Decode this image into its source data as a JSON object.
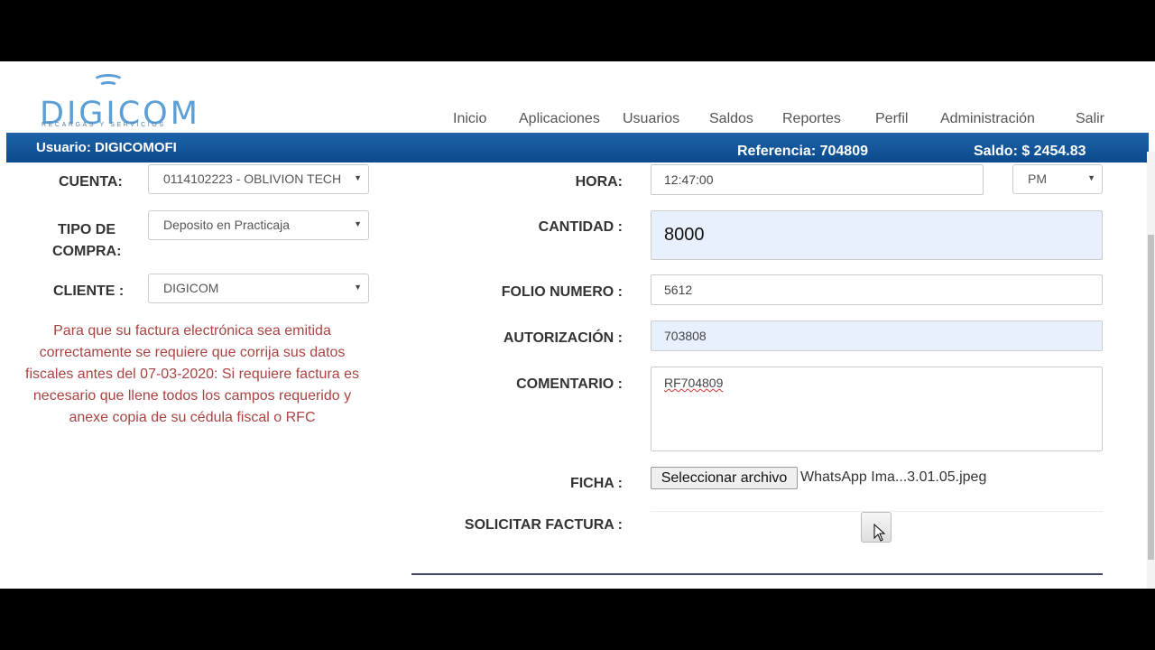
{
  "header": {
    "logo_text": "DIGICOM",
    "logo_subtitle": "RECARGAS Y SERVICIOS",
    "nav": [
      "Inicio",
      "Aplicaciones",
      "Usuarios",
      "Saldos",
      "Reportes",
      "Perfil",
      "Administración",
      "Salir"
    ]
  },
  "status_bar": {
    "usuario": "Usuario: DIGICOMOFI",
    "referencia": "Referencia: 704809",
    "saldo": "Saldo: $ 2454.83",
    "color": "#0b4a8c"
  },
  "form": {
    "cuenta_label": "CUENTA:",
    "cuenta_value": "0114102223 - OBLIVION TECH",
    "tipo_label_1": "TIPO DE",
    "tipo_label_2": "COMPRA:",
    "tipo_value": "Deposito en Practicaja",
    "cliente_label": "CLIENTE :",
    "cliente_value": "DIGICOM",
    "hora_label": "HORA:",
    "hora_value": "12:47:00",
    "ampm_value": "PM",
    "cantidad_label": "CANTIDAD :",
    "cantidad_value": "8000",
    "folio_label": "FOLIO NUMERO :",
    "folio_value": "5612",
    "autorizacion_label": "AUTORIZACIÓN :",
    "autorizacion_value": "703808",
    "comentario_label": "COMENTARIO :",
    "comentario_value": "RF704809",
    "ficha_label": "FICHA :",
    "file_button": "Seleccionar archivo",
    "file_name": "WhatsApp Ima...3.01.05.jpeg",
    "factura_label": "SOLICITAR FACTURA :"
  },
  "notice": "Para que su factura electrónica sea emitida correctamente se requiere que corrija sus datos fiscales antes del 07-03-2020: Si requiere factura es necesario que llene todos los campos requerido y anexe copia de su cédula fiscal o RFC",
  "colors": {
    "notice": "#a94442",
    "logo": "#5b9fd6",
    "highlight_field": "#e8f0fe"
  }
}
